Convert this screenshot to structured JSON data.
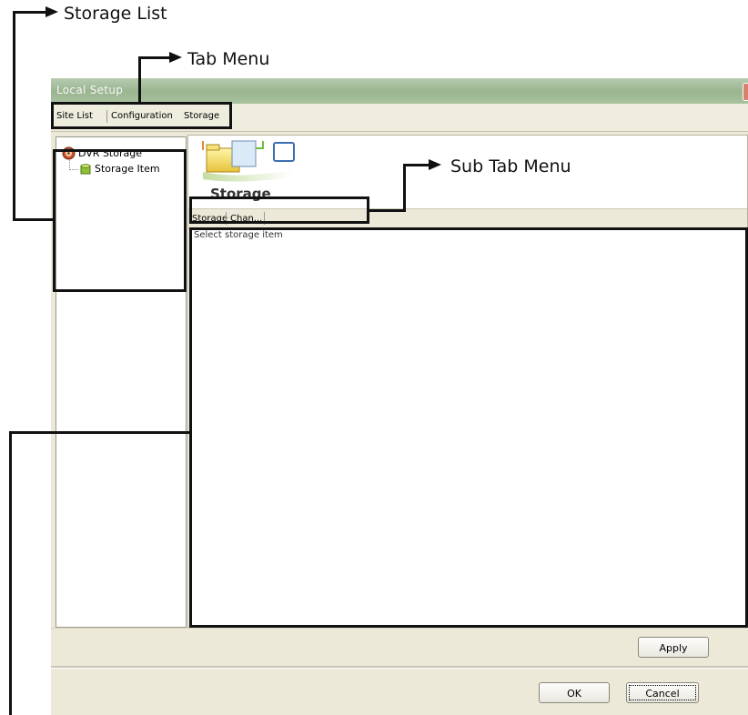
{
  "callouts": {
    "storage_list": "Storage List",
    "tab_menu": "Tab Menu",
    "sub_tab_menu": "Sub Tab Menu"
  },
  "window": {
    "title": "Local Setup",
    "close_glyph": "✕"
  },
  "tabs": [
    {
      "label": "Site List"
    },
    {
      "label": "Configuration"
    },
    {
      "label": "Storage"
    }
  ],
  "tree": {
    "root": {
      "label": "DVR Storage",
      "icon": "dvr-storage-icon"
    },
    "child": {
      "label": "Storage Item",
      "icon": "storage-item-icon"
    }
  },
  "header": {
    "title": "Storage",
    "icon": "storage-folder-icon"
  },
  "subtabs": [
    {
      "label": "Storage"
    },
    {
      "label": "Chan..."
    }
  ],
  "status_text": "Select storage item",
  "buttons": {
    "apply": "Apply",
    "ok": "OK",
    "cancel": "Cancel"
  }
}
